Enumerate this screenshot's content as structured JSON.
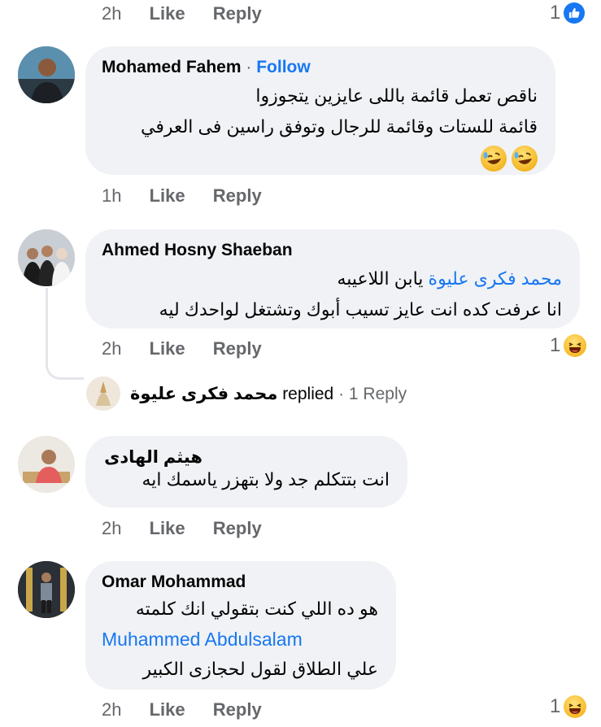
{
  "top_meta": {
    "time": "2h",
    "like": "Like",
    "reply": "Reply",
    "count": "1"
  },
  "comments": [
    {
      "name": "Mohamed Fahem",
      "separator": "·",
      "follow": "Follow",
      "lines": [
        "ناقص تعمل قائمة باللى عايزين يتجوزوا",
        "قائمة للستات وقائمة للرجال وتوفق راسين فى العرفي"
      ],
      "emoji": "rofl-icon",
      "time": "1h",
      "like": "Like",
      "reply": "Reply"
    },
    {
      "name": "Ahmed Hosny Shaeban",
      "mention": "محمد فكرى عليوة",
      "line1_rest": " يابن اللاعيبه",
      "line2": "انا عرفت كده انت عايز تسيب أبوك وتشتغل لواحدك ليه",
      "time": "2h",
      "like": "Like",
      "reply": "Reply",
      "count": "1",
      "replied": {
        "name": "محمد فكرى عليوة",
        "verb": "replied",
        "sep": "·",
        "count": "1 Reply"
      }
    },
    {
      "name": "هيثم الهادى",
      "line": "انت بتتكلم جد ولا بتهزر ياسمك ايه",
      "time": "2h",
      "like": "Like",
      "reply": "Reply"
    },
    {
      "name": "Omar Mohammad",
      "line1": "هو ده اللي كنت بتقولي انك كلمته",
      "mention": "Muhammed Abdulsalam",
      "line3": "علي الطلاق لقول لحجازى الكبير",
      "time": "2h",
      "like": "Like",
      "reply": "Reply",
      "count": "1"
    }
  ],
  "colors": {
    "link": "#1877f2",
    "bubble": "#f0f2f5",
    "meta": "#65676b"
  }
}
